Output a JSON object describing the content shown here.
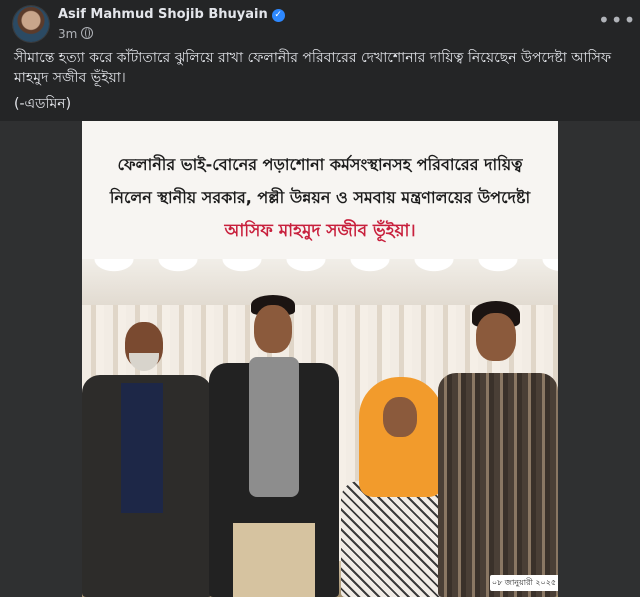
{
  "post": {
    "author": "Asif Mahmud Shojib Bhuyain",
    "time": "3m",
    "caption_text": "সীমান্তে হত্যা করে কাঁটাতারে ঝুলিয়ে রাখা ফেলানীর পরিবারের দেখাশোনার দায়িত্ব নিয়েছেন উপদেষ্টা আসিফ মাহমুদ সজীব ভূঁইয়া।",
    "caption_signature": "(-এডমিন)"
  },
  "image": {
    "line1": "ফেলানীর ভাই-বোনের পড়াশোনা কর্মসংস্থানসহ পরিবারের দায়িত্ব",
    "line2": "নিলেন স্থানীয় সরকার, পল্লী উন্নয়ন ও সমবায় মন্ত্রণালয়ের উপদেষ্টা",
    "line3": "আসিফ মাহমুদ সজীব ভূঁইয়া।",
    "date": "০৮ জানুয়ারী ২০২৫"
  },
  "icons": {
    "verified": "verified-badge-icon",
    "privacy": "globe-icon",
    "more": "more-options-icon"
  },
  "colors": {
    "background": "#242526",
    "text": "#e4e6eb",
    "secondary_text": "#b0b3b8",
    "verified": "#2d88ff",
    "highlight_red": "#c8203d"
  }
}
